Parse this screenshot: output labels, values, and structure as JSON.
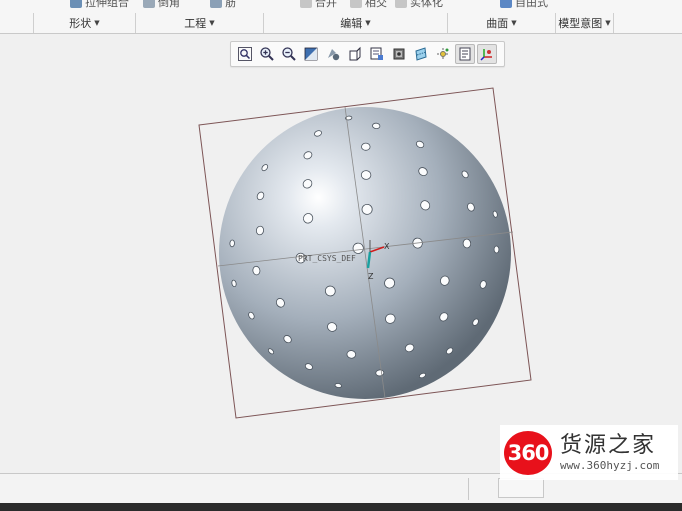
{
  "ribbon": {
    "top_buttons": [
      {
        "label": "拉伸组合",
        "icon": "extrude-icon"
      },
      {
        "label": "倒角",
        "icon": "chamfer-icon"
      },
      {
        "label": "筋",
        "icon": "rib-icon"
      },
      {
        "label": "合并",
        "icon": "merge-icon"
      },
      {
        "label": "相交",
        "icon": "intersect-icon"
      },
      {
        "label": "实体化",
        "icon": "solidify-icon"
      },
      {
        "label": "自由式",
        "icon": "freestyle-icon"
      }
    ],
    "groups": [
      {
        "label": "形状"
      },
      {
        "label": "工程"
      },
      {
        "label": "编辑"
      },
      {
        "label": "曲面"
      },
      {
        "label": "模型意图"
      }
    ]
  },
  "graphics_toolbar": {
    "buttons": [
      {
        "icon": "refit-icon"
      },
      {
        "icon": "zoom-in-icon"
      },
      {
        "icon": "zoom-out-icon"
      },
      {
        "icon": "repaint-icon"
      },
      {
        "icon": "display-style-icon"
      },
      {
        "icon": "saved-orientations-icon"
      },
      {
        "icon": "view-manager-icon"
      },
      {
        "icon": "perspective-icon"
      },
      {
        "icon": "datum-display-icon"
      },
      {
        "icon": "spin-center-icon"
      },
      {
        "icon": "annotation-display-icon",
        "active": true
      },
      {
        "icon": "csys-display-icon",
        "active": true
      }
    ]
  },
  "viewport": {
    "csys_label": "PRT_CSYS_DEF",
    "axis_x": "X",
    "axis_z": "Z"
  },
  "colors": {
    "sphere_light": "#e4e9ef",
    "sphere_mid": "#a4afbb",
    "sphere_dark": "#5f6a75",
    "bounding_box": "#7d5556",
    "axis_line": "#8a8a8a",
    "csys_x": "#d11a1a",
    "csys_y": "#1aa0a0"
  },
  "watermark": {
    "logo_text": "360",
    "site_name": "货源之家",
    "url": "www.360hyzj.com"
  }
}
